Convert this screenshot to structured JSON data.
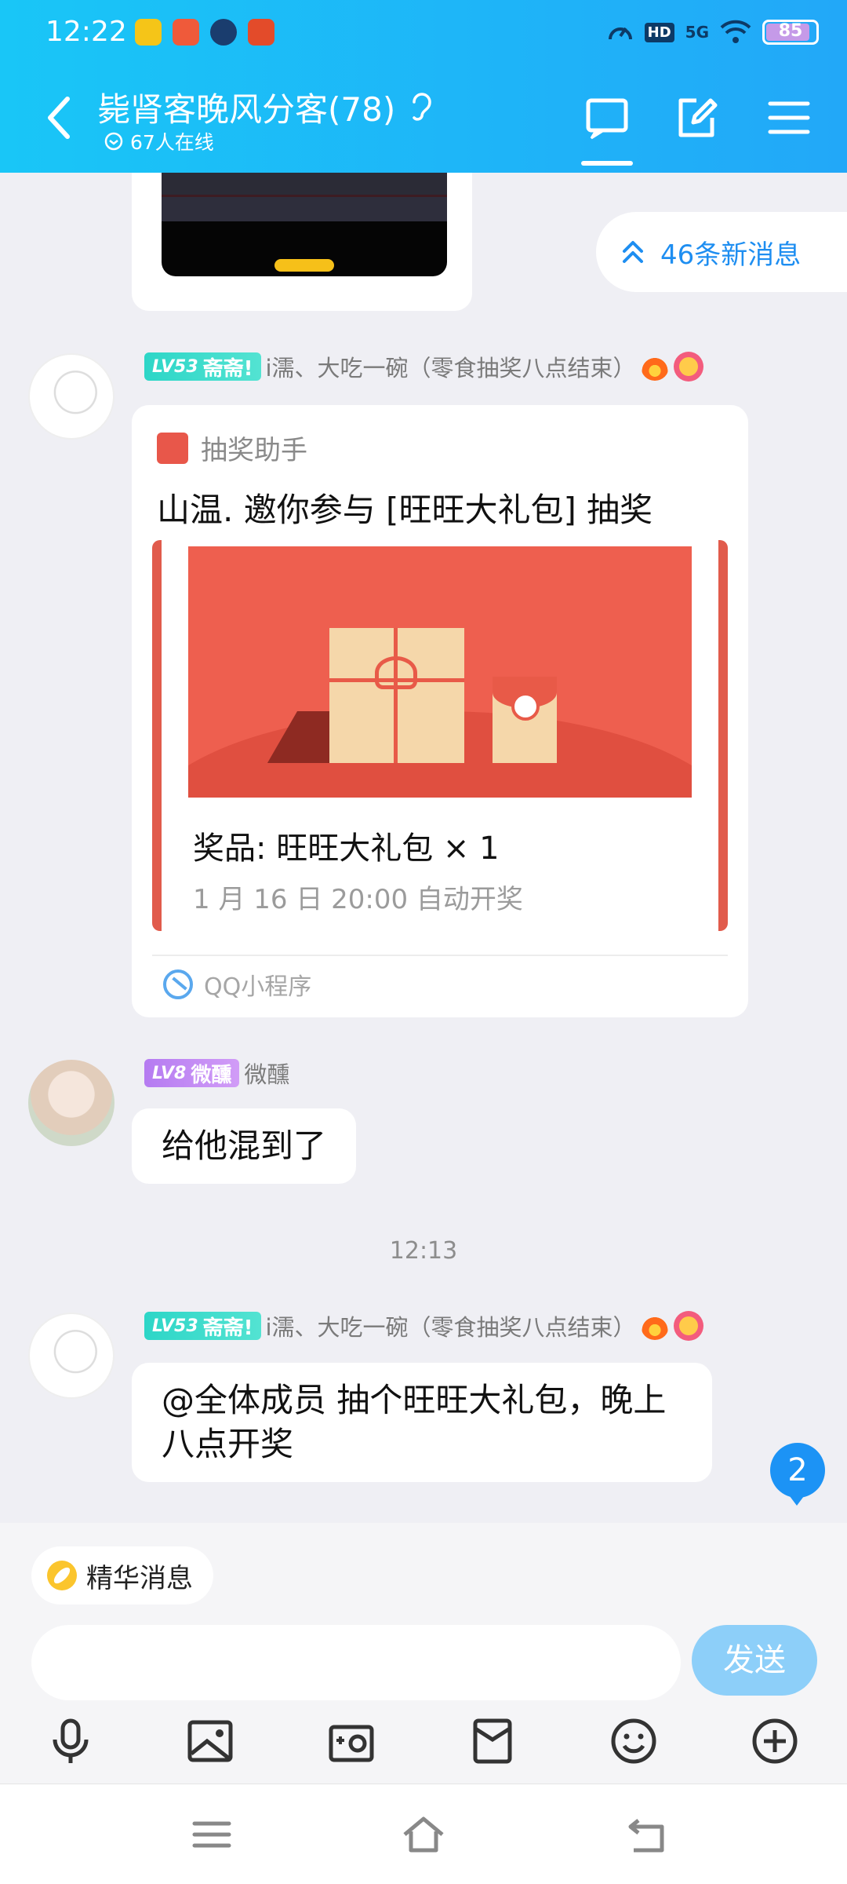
{
  "status_bar": {
    "time": "12:22",
    "network_badge": "HD",
    "signal_label": "5G",
    "battery": "85",
    "notification_icons": [
      "coin-app-icon",
      "shop-app-icon",
      "message-app-icon",
      "game-app-icon"
    ]
  },
  "header": {
    "title": "毙肾客晚风分客(78)",
    "online_text": "67人在线",
    "tabs": [
      "chat-tab",
      "edit",
      "menu"
    ]
  },
  "new_messages": {
    "label": "46条新消息"
  },
  "messages": [
    {
      "level": "LV53",
      "title_badge": "斋斋!",
      "sender": "i濡、大吃一碗（零食抽奖八点结束）",
      "type": "lottery",
      "card": {
        "source": "抽奖助手",
        "title": "山温. 邀你参与 [旺旺大礼包] 抽奖",
        "prize": "奖品: 旺旺大礼包  × 1",
        "draw_time": "1 月 16 日 20:00 自动开奖",
        "footer": "QQ小程序"
      }
    },
    {
      "level": "LV8",
      "title_badge": "微醺",
      "sender": "微醺",
      "type": "text",
      "text": "给他混到了"
    },
    {
      "level": "LV53",
      "title_badge": "斋斋!",
      "sender": "i濡、大吃一碗（零食抽奖八点结束）",
      "type": "text",
      "text": "@全体成员 抽个旺旺大礼包，晚上八点开奖"
    }
  ],
  "time_separator": "12:13",
  "unread_count": "2",
  "input": {
    "essence_label": "精华消息",
    "placeholder": "",
    "send_label": "发送"
  },
  "toolbar_icons": [
    "microphone-icon",
    "image-icon",
    "camera-icon",
    "red-packet-icon",
    "emoji-icon",
    "plus-icon"
  ],
  "colors": {
    "header_start": "#19c6f7",
    "header_end": "#22a8f8",
    "accent": "#1e8ef1",
    "send_button": "#8dcff9",
    "lottery_red": "#e15b4c"
  }
}
